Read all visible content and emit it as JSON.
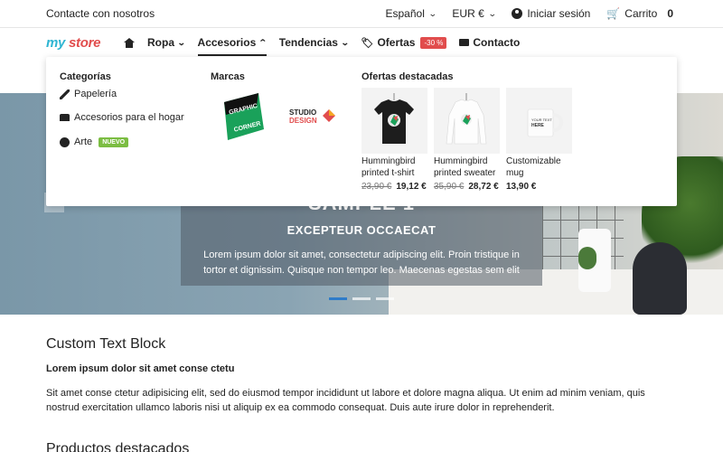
{
  "topbar": {
    "contact": "Contacte con nosotros",
    "language": "Español",
    "currency": "EUR €",
    "login": "Iniciar sesión",
    "cart_label": "Carrito",
    "cart_count": "0"
  },
  "nav": {
    "logo_my": "my",
    "logo_store": "store",
    "items": [
      {
        "label": "Ropa"
      },
      {
        "label": "Accesorios"
      },
      {
        "label": "Tendencias"
      },
      {
        "label": "Ofertas",
        "badge": "-30 %"
      },
      {
        "label": "Contacto"
      }
    ]
  },
  "dropdown": {
    "categories_title": "Categorías",
    "categories": [
      {
        "label": "Papelería",
        "icon": "pencil-icon"
      },
      {
        "label": "Accesorios para el hogar",
        "icon": "sofa-icon"
      },
      {
        "label": "Arte",
        "icon": "palette-icon",
        "badge": "NUEVO"
      }
    ],
    "brands_title": "Marcas",
    "brands": [
      {
        "name_lines": [
          "GRAPHIC",
          "CORNER"
        ]
      },
      {
        "name_lines": [
          "STUDIO",
          "DESIGN"
        ]
      }
    ],
    "offers_title": "Ofertas destacadas",
    "offers": [
      {
        "name": "Hummingbird printed t-shirt",
        "old_price": "23,90 €",
        "price": "19,12 €"
      },
      {
        "name": "Hummingbird printed sweater",
        "old_price": "35,90 €",
        "price": "28,72 €"
      },
      {
        "name": "Customizable mug",
        "old_price": "",
        "price": "13,90 €"
      }
    ],
    "mug_text": [
      "YOUR TEXT",
      "HERE"
    ]
  },
  "hero": {
    "title": "SAMPLE 1",
    "subtitle": "EXCEPTEUR OCCAECAT",
    "text": "Lorem ipsum dolor sit amet, consectetur adipiscing elit. Proin tristique in tortor et dignissim. Quisque non tempor leo. Maecenas egestas sem elit"
  },
  "content": {
    "title": "Custom Text Block",
    "bold": "Lorem ipsum dolor sit amet conse ctetu",
    "text": "Sit amet conse ctetur adipisicing elit, sed do eiusmod tempor incididunt ut labore et dolore magna aliqua. Ut enim ad minim veniam, quis nostrud exercitation ullamco laboris nisi ut aliquip ex ea commodo consequat. Duis aute irure dolor in reprehenderit.",
    "section_title": "Productos destacados"
  }
}
